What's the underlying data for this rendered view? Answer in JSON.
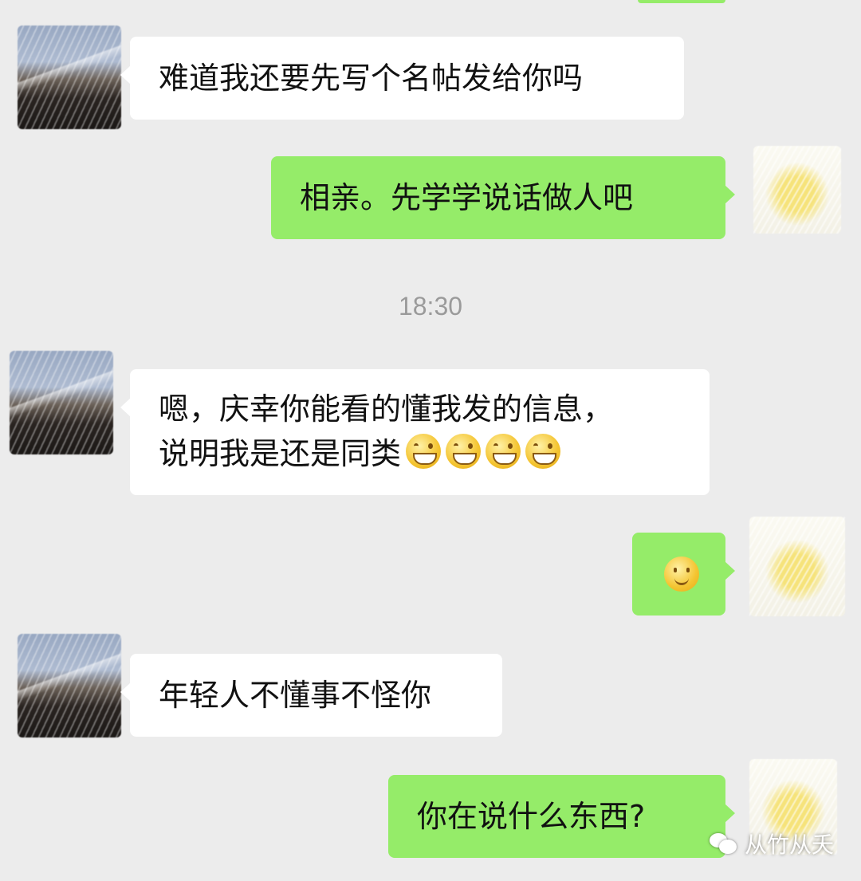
{
  "chat": {
    "messages": [
      {
        "side": "in",
        "text": "难道我还要先写个名帖发给你吗"
      },
      {
        "side": "out",
        "text": "相亲。先学学说话做人吧"
      },
      {
        "side": "in",
        "text_line1": "嗯，庆幸你能看的懂我发的信息，",
        "text_line2": "说明我是还是同类",
        "emojis": [
          "grin-emoji",
          "grin-emoji",
          "grin-emoji",
          "grin-emoji"
        ]
      },
      {
        "side": "out",
        "emoji": "blush-smile-emoji"
      },
      {
        "side": "in",
        "text": "年轻人不懂事不怪你"
      },
      {
        "side": "out",
        "text": "你在说什么东西?"
      }
    ],
    "timestamp": "18:30"
  },
  "watermark": {
    "text": "从竹从夭",
    "icon": "wechat-icon"
  },
  "colors": {
    "background": "#ececec",
    "incoming_bubble": "#ffffff",
    "outgoing_bubble": "#95ec69",
    "timestamp": "#9a9a9a"
  }
}
